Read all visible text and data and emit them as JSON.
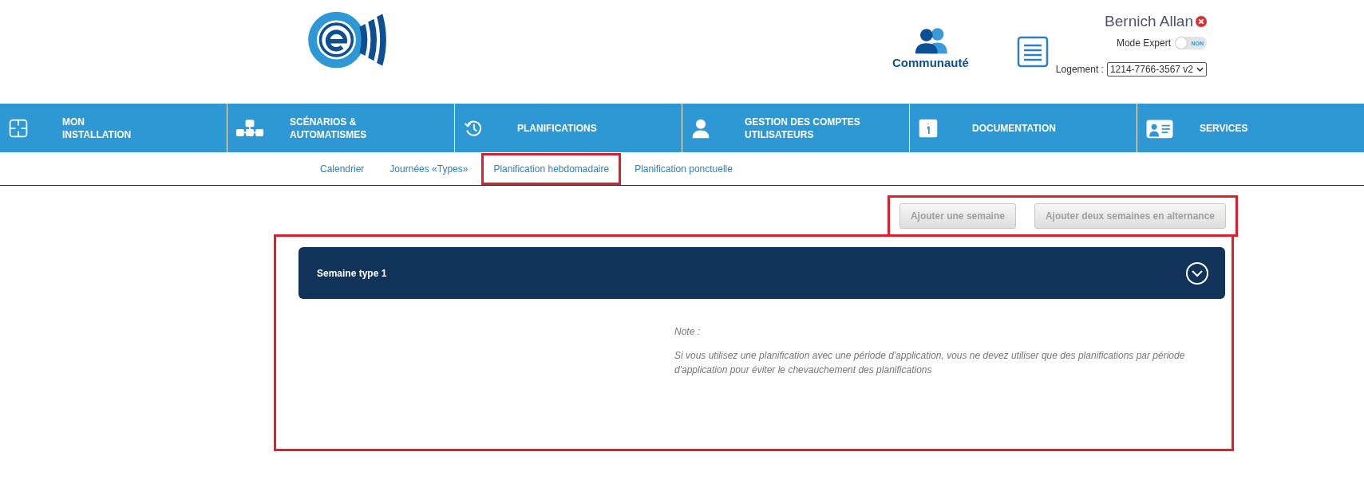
{
  "header": {
    "community_label": "Communauté",
    "user_name": "Bernich Allan",
    "expert_mode": {
      "label": "Mode Expert",
      "on": false,
      "state_text": "NON"
    },
    "housing": {
      "label": "Logement :",
      "value": "1214-7766-3567 v2"
    }
  },
  "nav": [
    {
      "label": "MON\nINSTALLATION"
    },
    {
      "label": "SCÉNARIOS &\nAUTOMATISMES"
    },
    {
      "label": "PLANIFICATIONS"
    },
    {
      "label": "GESTION DES COMPTES\nUTILISATEURS"
    },
    {
      "label": "DOCUMENTATION"
    },
    {
      "label": "SERVICES"
    }
  ],
  "subnav": [
    {
      "label": "Calendrier",
      "selected": false
    },
    {
      "label": "Journées «Types»",
      "selected": false
    },
    {
      "label": "Planification hebdomadaire",
      "selected": true
    },
    {
      "label": "Planification ponctuelle",
      "selected": false
    }
  ],
  "actions": [
    {
      "label": "Ajouter une semaine",
      "disabled": true
    },
    {
      "label": "Ajouter deux semaines en alternance",
      "disabled": true
    }
  ],
  "weeks": [
    {
      "title": "Semaine type 1",
      "expanded": false
    }
  ],
  "note": {
    "title": "Note :",
    "text": "Si vous utilisez une planification avec une période d'application, vous ne devez utiliser que des planifications par période d'application pour éviter le chevauchement des planifications"
  }
}
